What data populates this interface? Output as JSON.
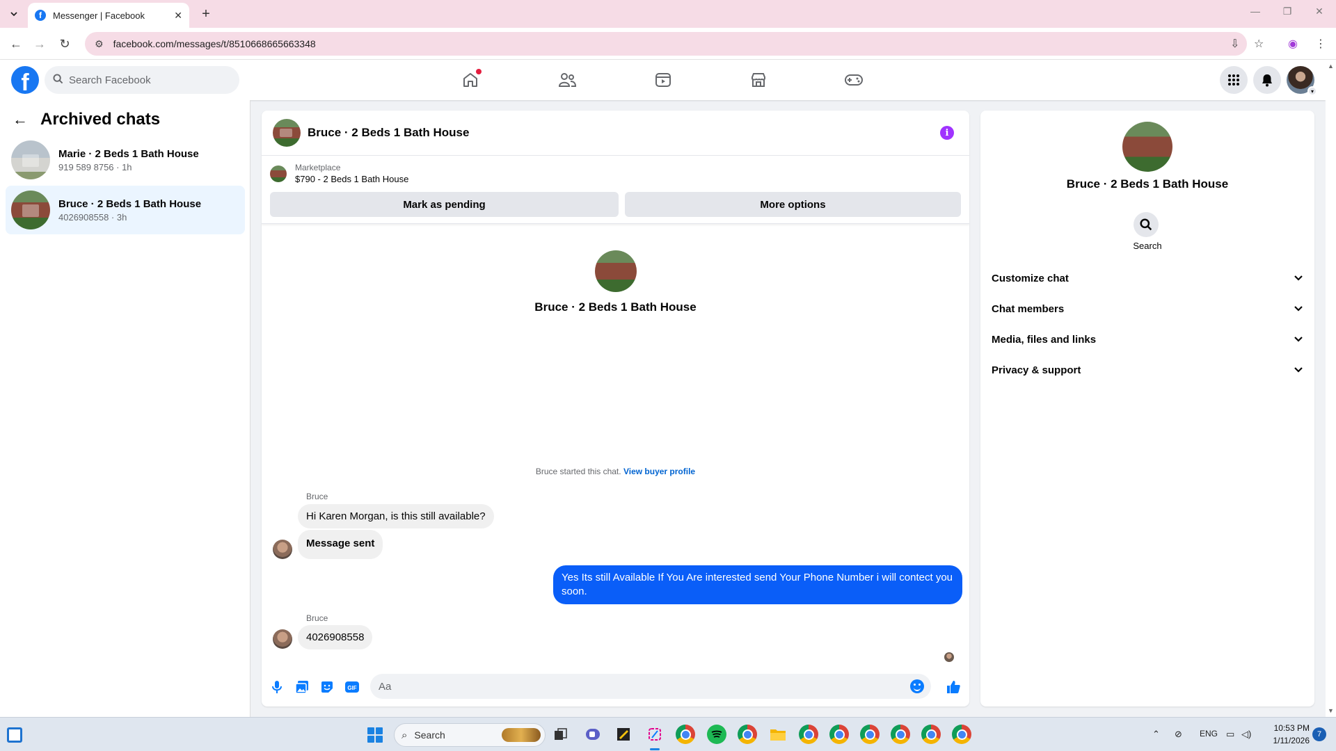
{
  "browser": {
    "tab_title": "Messenger | Facebook",
    "url": "facebook.com/messages/t/8510668665663348"
  },
  "fb_header": {
    "search_placeholder": "Search Facebook",
    "nav_icons": [
      "home-icon",
      "friends-icon",
      "video-icon",
      "marketplace-icon",
      "gaming-icon"
    ],
    "home_has_notification": true,
    "right_icons": [
      "menu-grid-icon",
      "notifications-bell-icon"
    ]
  },
  "left_panel": {
    "title": "Archived chats",
    "chats": [
      {
        "name": "Marie · 2 Beds 1 Bath House",
        "subtitle": "919 589 8756 · 1h",
        "active": false
      },
      {
        "name": "Bruce · 2 Beds 1 Bath House",
        "subtitle": "4026908558 · 3h",
        "active": true
      }
    ]
  },
  "chat": {
    "title": "Bruce · 2 Beds 1 Bath House",
    "marketplace": {
      "label": "Marketplace",
      "listing": "$790 - 2 Beds 1 Bath House",
      "mark_pending_label": "Mark as pending",
      "more_options_label": "More options"
    },
    "conversation_name": "Bruce · 2 Beds 1 Bath House",
    "started_text": "Bruce started this chat.",
    "view_buyer_profile": "View buyer profile",
    "messages": [
      {
        "sender": "Bruce",
        "text": "Hi Karen Morgan, is this still available?"
      },
      {
        "sender": "",
        "text": "Message sent"
      },
      {
        "sender": "me",
        "text": "Yes Its still Available If You Are interested send Your Phone Number i will contect you soon."
      },
      {
        "sender": "Bruce",
        "text": "4026908558"
      }
    ],
    "composer_placeholder": "Aa"
  },
  "right_panel": {
    "name": "Bruce · 2 Beds 1 Bath House",
    "search_label": "Search",
    "sections": [
      "Customize chat",
      "Chat members",
      "Media, files and links",
      "Privacy & support"
    ]
  },
  "taskbar": {
    "search_label": "Search",
    "language": "ENG",
    "time": "10:53 PM",
    "date": "1/11/2026",
    "notification_count": "7"
  },
  "colors": {
    "fb_blue": "#1877f2",
    "outgoing_bubble": "#0a5ef8",
    "info_icon": "#a033ff",
    "link": "#0064d1"
  }
}
